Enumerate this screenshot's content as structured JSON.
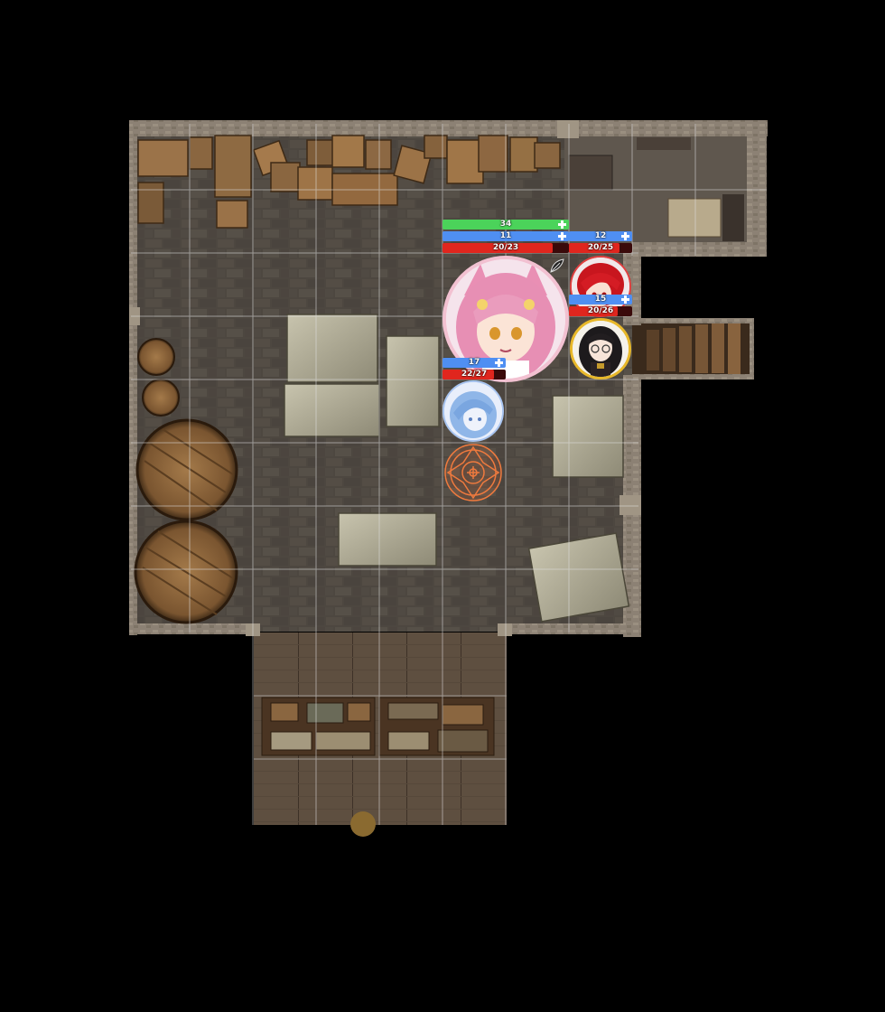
{
  "scene": {
    "name": "Warehouse battle map",
    "colors": {
      "background": "#000000",
      "floor": "#5a534b",
      "wall": "#8a7f72",
      "grid": "#d8d8d8"
    }
  },
  "tokens": [
    {
      "id": "pink-fox-girl",
      "icon": "pink-haired-fox-girl-portrait",
      "ring_color": "#f2c1d1",
      "status_icon": "leaf-icon",
      "bars": [
        {
          "type": "green",
          "value": "34"
        },
        {
          "type": "blue",
          "value": "11"
        },
        {
          "type": "red",
          "value": "20/23",
          "fraction": 0.87
        }
      ]
    },
    {
      "id": "red-haired-rogue",
      "icon": "red-haired-character-portrait",
      "ring_color": "#e04040",
      "bars": [
        {
          "type": "blue",
          "value": "12"
        },
        {
          "type": "red",
          "value": "20/25",
          "fraction": 0.8
        }
      ]
    },
    {
      "id": "black-haired-scholar",
      "icon": "black-haired-glasses-portrait",
      "ring_color": "#e8b82a",
      "bars": [
        {
          "type": "blue",
          "value": "15"
        },
        {
          "type": "red",
          "value": "20/26",
          "fraction": 0.77
        }
      ]
    },
    {
      "id": "blue-spirit",
      "icon": "blue-haired-spirit-portrait",
      "ring_color": "#a8c4f0",
      "bars": [
        {
          "type": "blue",
          "value": "17"
        },
        {
          "type": "red",
          "value": "22/27",
          "fraction": 0.81
        }
      ]
    }
  ],
  "markers": [
    {
      "id": "magic-circle",
      "icon": "orange-magic-circle-icon",
      "color": "#e8743a"
    }
  ]
}
